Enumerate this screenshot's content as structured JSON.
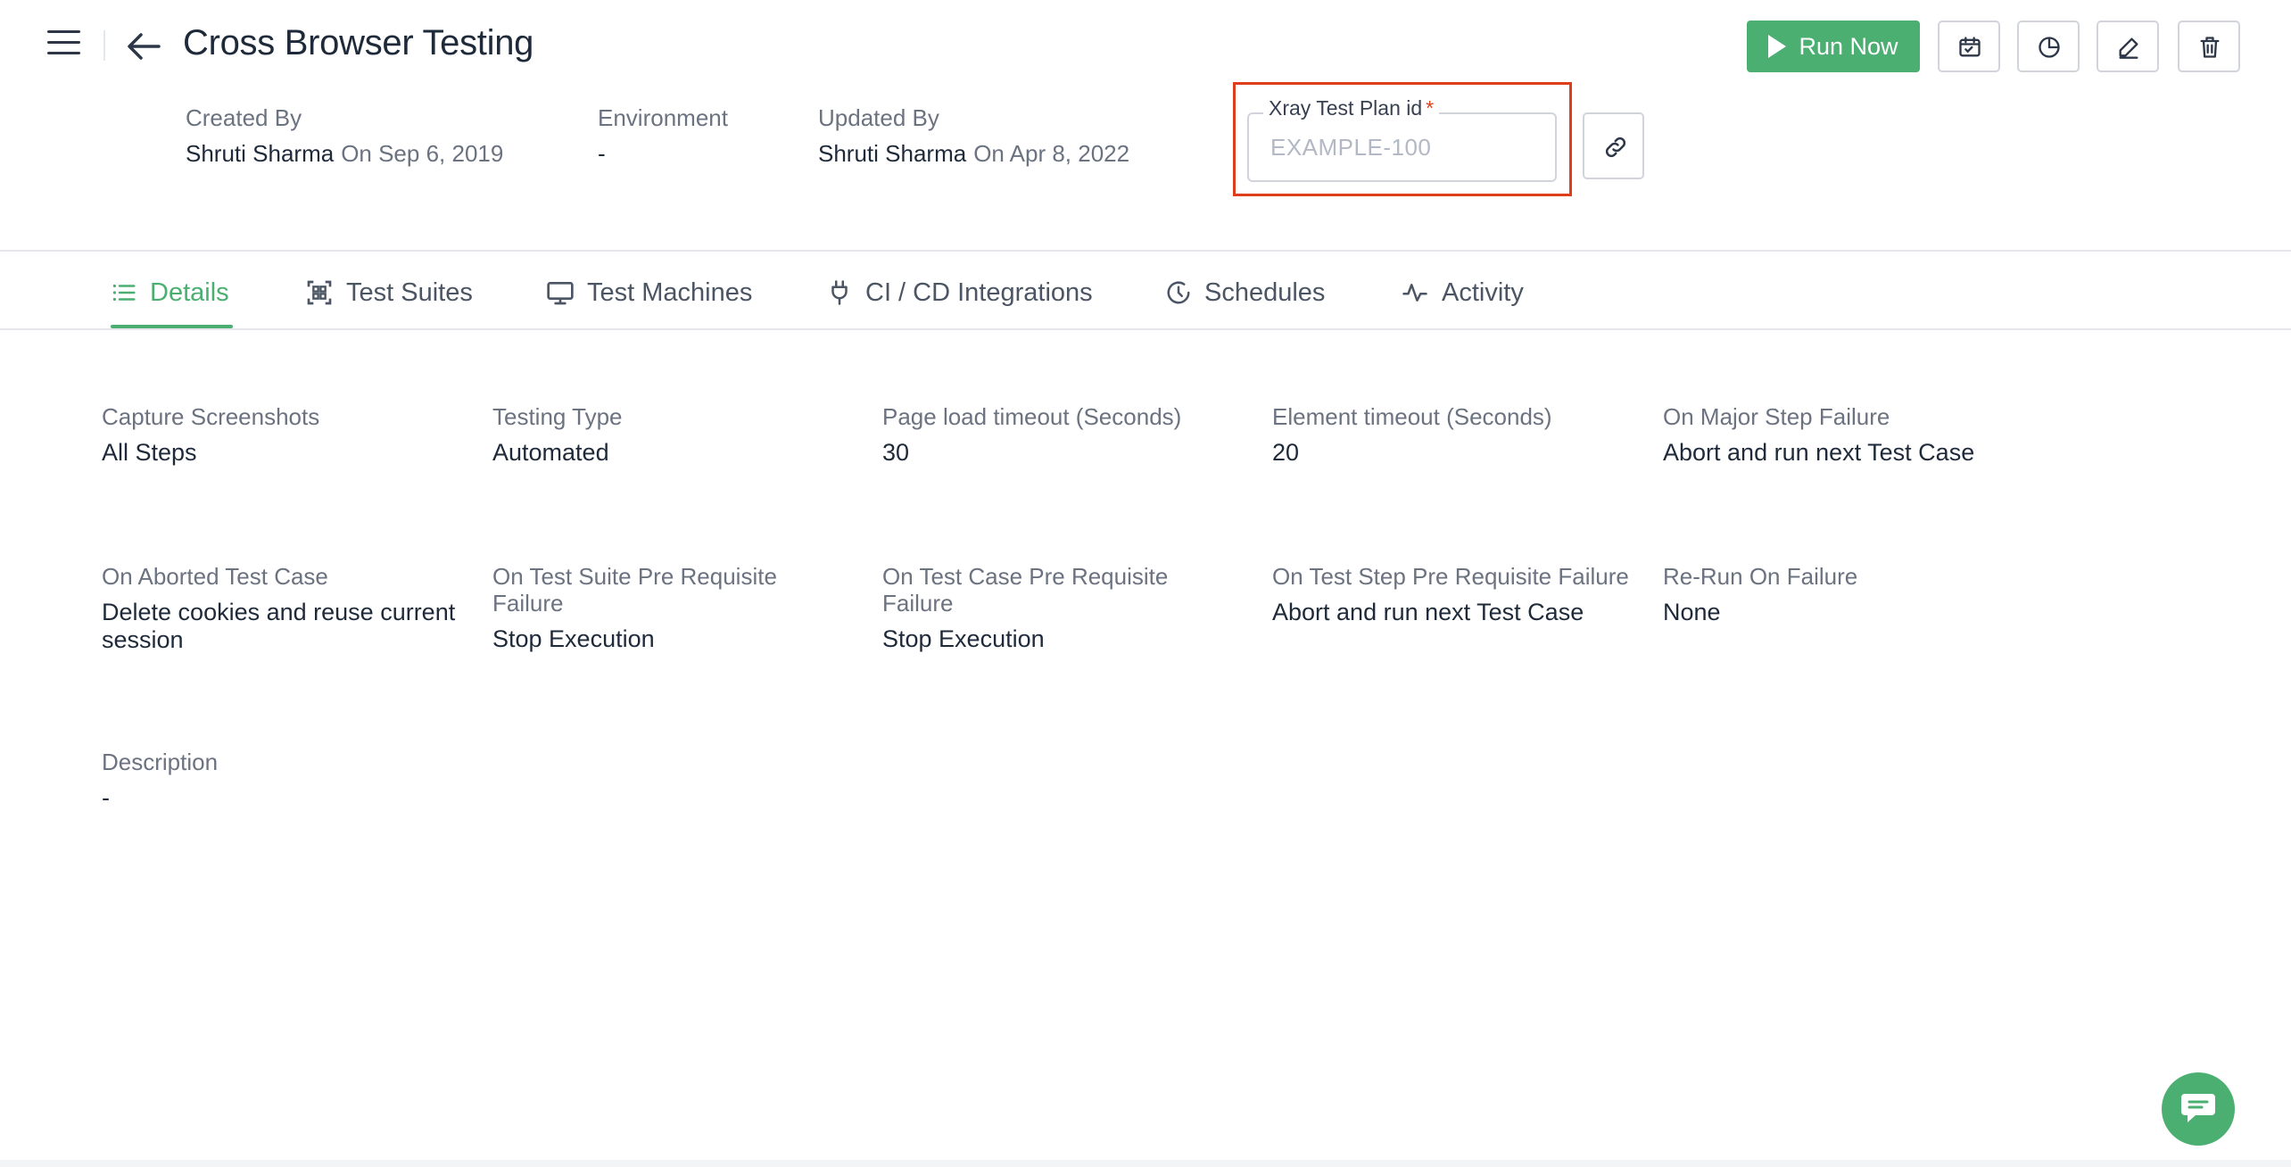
{
  "header": {
    "title": "Cross Browser Testing",
    "created_by": {
      "label": "Created By",
      "name": "Shruti Sharma",
      "date": "On Sep 6, 2019"
    },
    "environment": {
      "label": "Environment",
      "value": "-"
    },
    "updated_by": {
      "label": "Updated By",
      "name": "Shruti Sharma",
      "date": "On Apr 8, 2022"
    },
    "xray": {
      "label": "Xray Test Plan id",
      "required_mark": "*",
      "placeholder": "EXAMPLE-100",
      "value": ""
    },
    "run_button": "Run Now",
    "toolbar_icons": [
      "calendar-icon",
      "pie-chart-icon",
      "edit-icon",
      "trash-icon"
    ]
  },
  "tabs": [
    {
      "label": "Details",
      "icon": "list-icon",
      "active": true
    },
    {
      "label": "Test Suites",
      "icon": "test-suites-icon",
      "active": false
    },
    {
      "label": "Test Machines",
      "icon": "monitor-icon",
      "active": false
    },
    {
      "label": "CI / CD Integrations",
      "icon": "plug-icon",
      "active": false
    },
    {
      "label": "Schedules",
      "icon": "clock-icon",
      "active": false
    },
    {
      "label": "Activity",
      "icon": "activity-icon",
      "active": false
    }
  ],
  "details": [
    {
      "label": "Capture Screenshots",
      "value": "All Steps"
    },
    {
      "label": "Testing Type",
      "value": "Automated"
    },
    {
      "label": "Page load timeout (Seconds)",
      "value": "30"
    },
    {
      "label": "Element timeout (Seconds)",
      "value": "20"
    },
    {
      "label": "On Major Step Failure",
      "value": "Abort and run next Test Case"
    },
    {
      "label": "On Aborted Test Case",
      "value": "Delete cookies and reuse current session"
    },
    {
      "label": "On Test Suite Pre Requisite Failure",
      "value": "Stop Execution"
    },
    {
      "label": "On Test Case Pre Requisite Failure",
      "value": "Stop Execution"
    },
    {
      "label": "On Test Step Pre Requisite Failure",
      "value": "Abort and run next Test Case"
    },
    {
      "label": "Re-Run On Failure",
      "value": "None"
    },
    {
      "label": "Description",
      "value": "-"
    }
  ],
  "colors": {
    "accent": "#4caf72",
    "highlight": "#e03e1a",
    "text": "#1e2a3a",
    "muted": "#6b7280"
  }
}
